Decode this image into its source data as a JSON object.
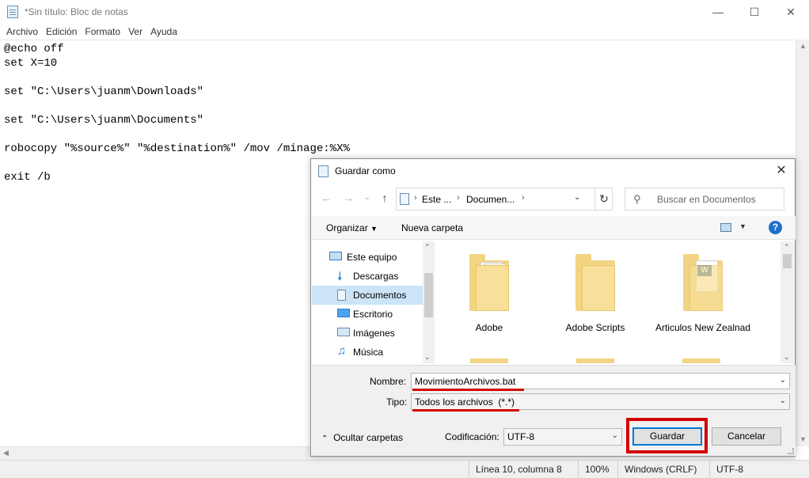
{
  "notepad": {
    "title": "*Sin título: Bloc de notas",
    "menu": [
      "Archivo",
      "Edición",
      "Formato",
      "Ver",
      "Ayuda"
    ],
    "content": "@echo off\nset X=10\n\nset \"C:\\Users\\juanm\\Downloads\"\n\nset \"C:\\Users\\juanm\\Documents\"\n\nrobocopy \"%source%\" \"%destination%\" /mov /minage:%X%\n\nexit /b",
    "status": {
      "position": "Línea 10, columna 8",
      "zoom": "100%",
      "line_ending": "Windows (CRLF)",
      "encoding": "UTF-8"
    }
  },
  "dialog": {
    "title": "Guardar como",
    "breadcrumb": [
      "Este ...",
      "Documen..."
    ],
    "search_placeholder": "Buscar en Documentos",
    "toolbar": {
      "organize": "Organizar",
      "new_folder": "Nueva carpeta"
    },
    "nav_items": [
      {
        "label": "Este equipo",
        "icon": "computer-icon"
      },
      {
        "label": "Descargas",
        "icon": "download-arrow-icon"
      },
      {
        "label": "Documentos",
        "icon": "document-icon",
        "selected": true
      },
      {
        "label": "Escritorio",
        "icon": "desktop-icon"
      },
      {
        "label": "Imágenes",
        "icon": "image-icon"
      },
      {
        "label": "Música",
        "icon": "music-note-icon"
      }
    ],
    "files": [
      {
        "label": "Adobe",
        "icon": "folder-with-docs-icon"
      },
      {
        "label": "Adobe Scripts",
        "icon": "folder-icon"
      },
      {
        "label": "Articulos New Zealnad",
        "icon": "folder-with-word-doc-icon"
      }
    ],
    "name_label": "Nombre:",
    "name_value": "MovimientoArchivos.bat",
    "type_label": "Tipo:",
    "type_value": "Todos los archivos  (*.*)",
    "hide_folders": "Ocultar carpetas",
    "encoding_label": "Codificación:",
    "encoding_value": "UTF-8",
    "save_button": "Guardar",
    "cancel_button": "Cancelar",
    "highlight_color": "#d40000"
  }
}
